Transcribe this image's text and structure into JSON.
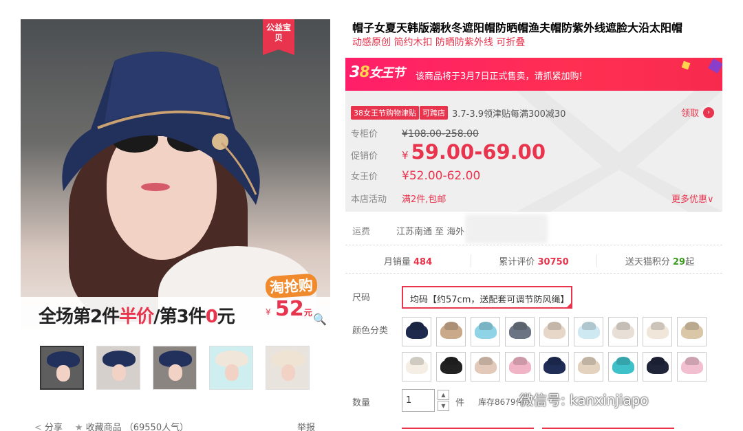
{
  "gallery": {
    "badge": "公益宝贝",
    "promo_text_a": "全场第2件",
    "promo_text_b": "半价",
    "promo_text_c": "/第3件",
    "promo_text_d": "0",
    "promo_text_e": "元",
    "taoqiang_title": "淘抢购",
    "taoqiang_yen": "¥",
    "taoqiang_price": "52",
    "taoqiang_unit": "元",
    "zoom_icon": "magnifier-icon",
    "thumbnails": [
      "thumb-1",
      "thumb-2",
      "thumb-3",
      "thumb-4",
      "thumb-5"
    ]
  },
  "actions": {
    "share": "分享",
    "favorite": "收藏商品",
    "popularity": "（69550人气）",
    "report": "举报"
  },
  "product": {
    "title": "帽子女夏天韩版潮秋冬遮阳帽防晒帽渔夫帽防紫外线遮脸大沿太阳帽",
    "subtitle": "动感原创 简约木扣 防晒防紫外线 可折叠"
  },
  "festival": {
    "logo_a": "3",
    "logo_b": "8",
    "logo_c": "女王节",
    "message": "该商品将于3月7日正式售卖，请抓紧加购!"
  },
  "coupon": {
    "tag": "38女王节购物津贴",
    "tag2": "可跨店",
    "text": "3.7-3.9领津贴每满300减30",
    "claim": "领取",
    "claim_icon": "›"
  },
  "prices": {
    "counter_label": "专柜价",
    "counter_value": "¥108.00-258.00",
    "promo_label": "促销价",
    "promo_yen": "¥",
    "promo_value": "59.00-69.00",
    "queen_label": "女王价",
    "queen_value": "¥52.00-62.00",
    "activity_label": "本店活动",
    "activity_value": "满2件,包邮",
    "more": "更多优惠∨"
  },
  "shipping": {
    "label": "运费",
    "route": "江苏南通 至 海外"
  },
  "stats": {
    "monthly_label": "月销量",
    "monthly_value": "484",
    "reviews_label": "累计评价",
    "reviews_value": "30750",
    "points_label": "送天猫积分",
    "points_value": "29",
    "points_suffix": "起"
  },
  "options": {
    "size_label": "尺码",
    "size_value": "均码【约57cm，送配套可调节防风绳】",
    "color_label": "颜色分类",
    "swatch_colors": [
      "#1d2a4d",
      "#c9a98a",
      "#8fd3e6",
      "#6b7482",
      "#e7d7c8",
      "#cfe9f3",
      "#e8e0d6",
      "#f0e6da",
      "#d9c7a8",
      "#f4eee4",
      "#222222",
      "#e2c9b9",
      "#f1b3c6",
      "#1f2d57",
      "#e2d2be",
      "#3fc1c9",
      "#20253a",
      "#f1bfcf"
    ]
  },
  "quantity": {
    "label": "数量",
    "value": "1",
    "unit": "件",
    "stock": "库存8679件"
  },
  "watermark": "微信号: kanxinjiapo"
}
